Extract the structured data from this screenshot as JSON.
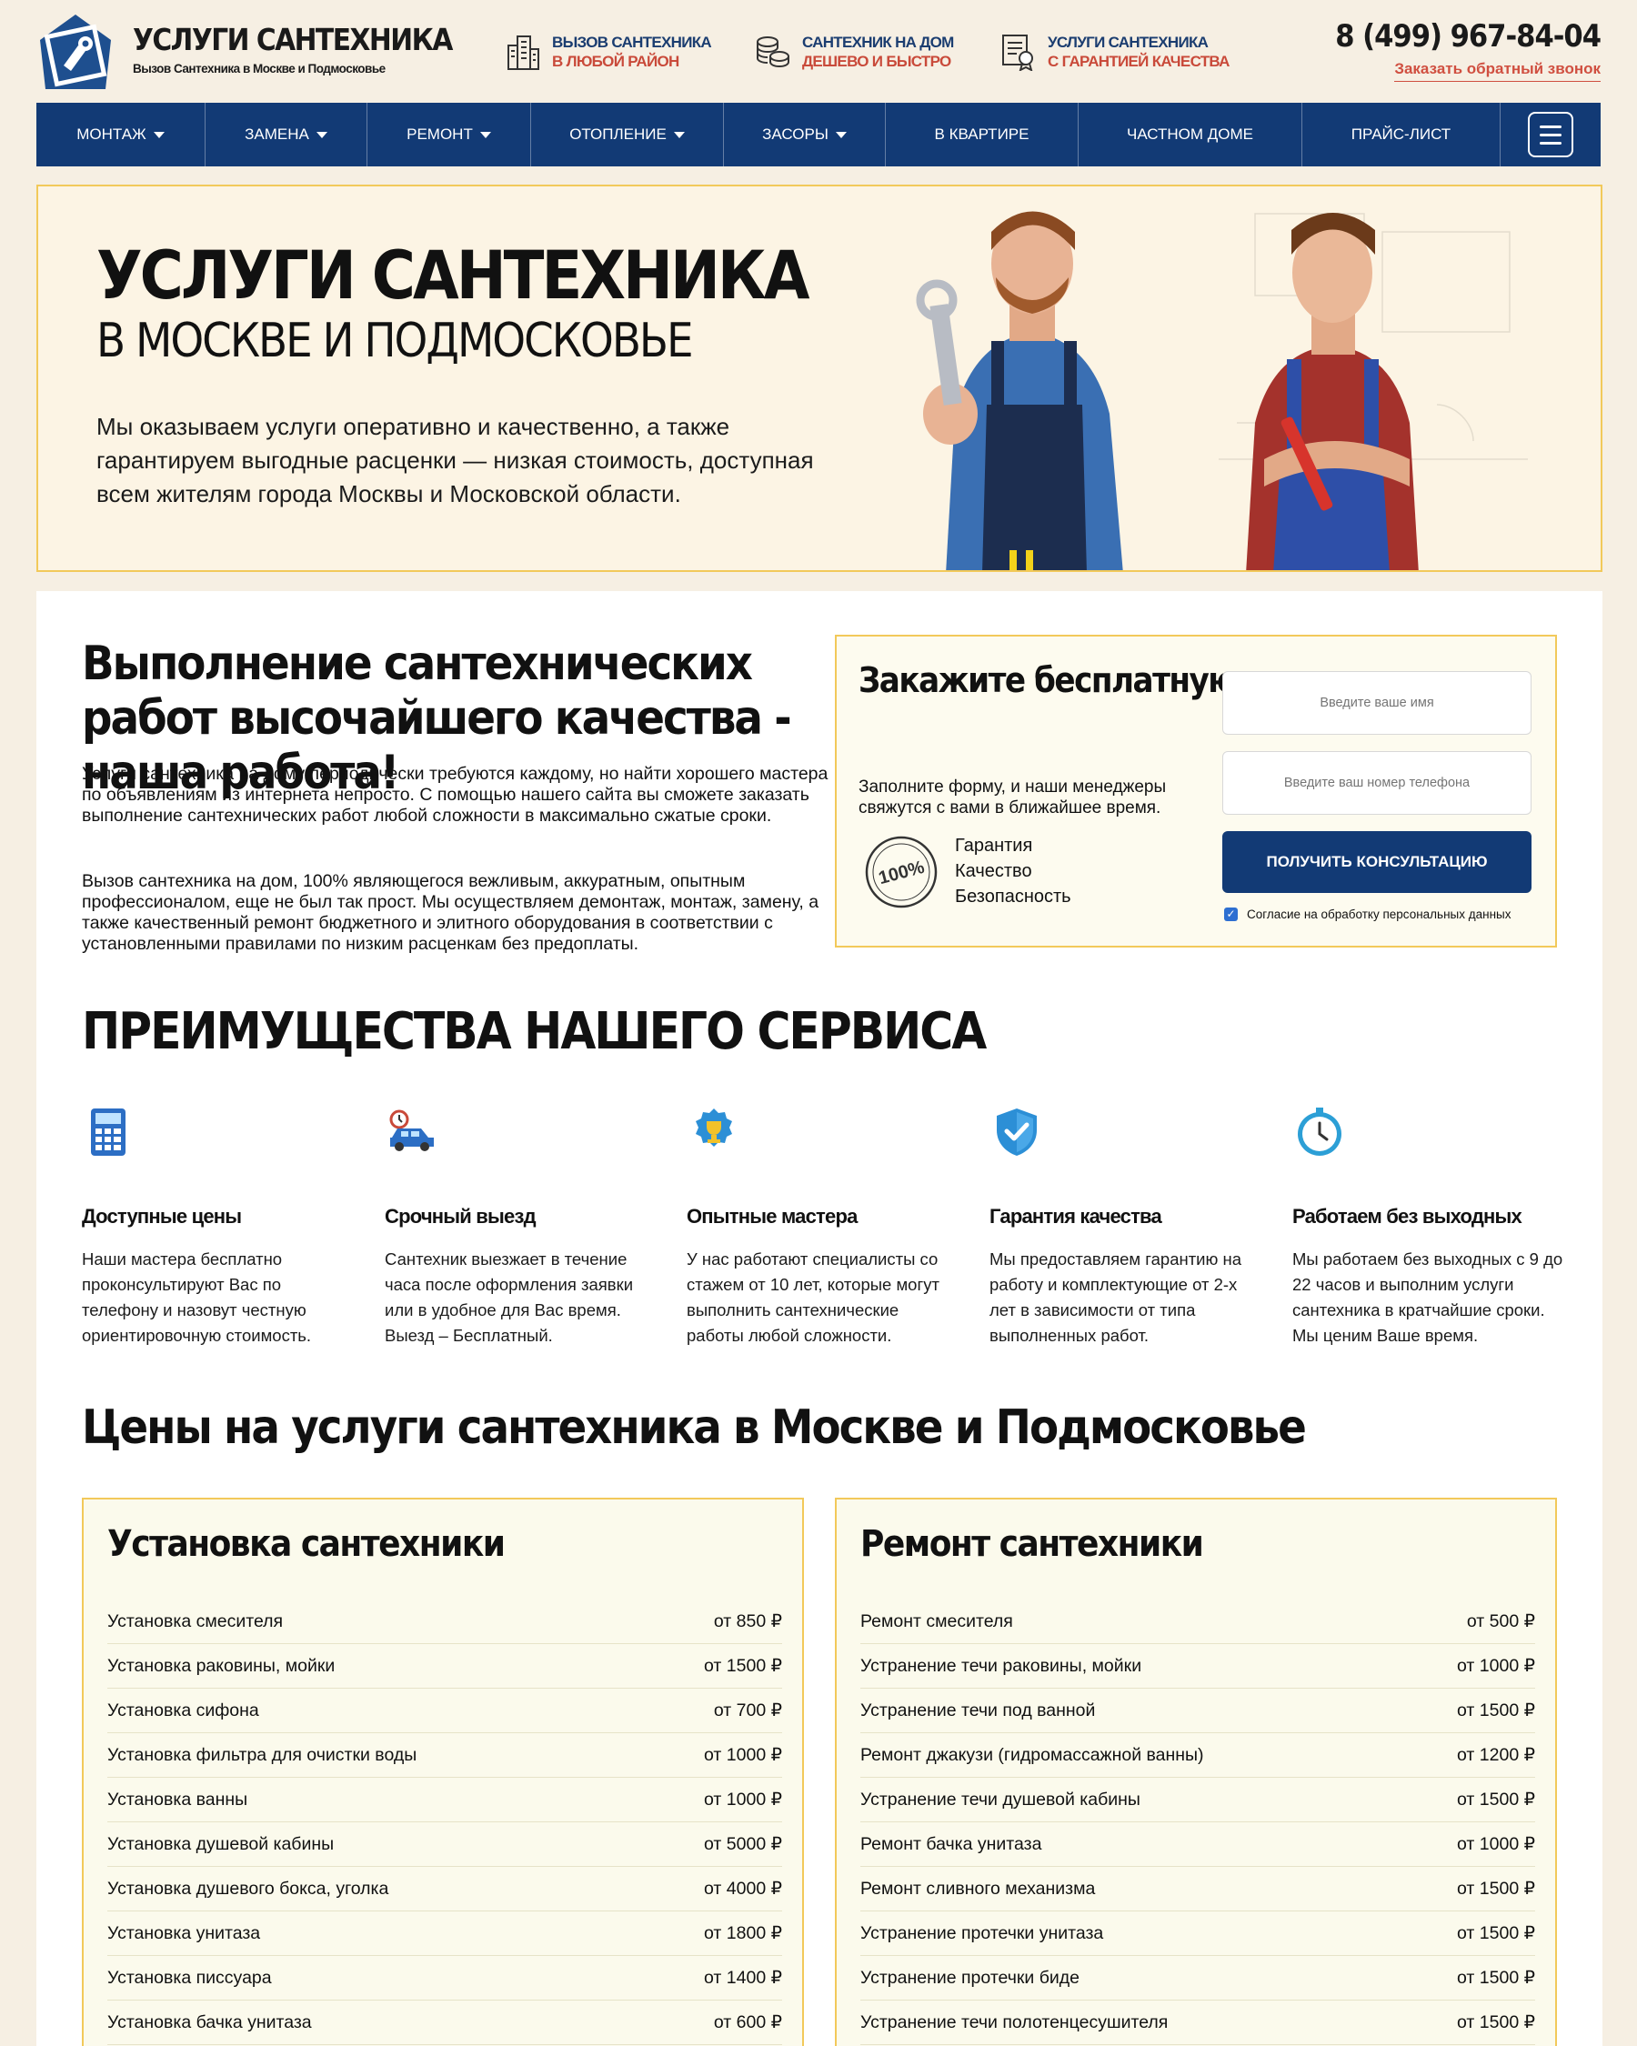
{
  "header": {
    "brand_title": "УСЛУГИ САНТЕХНИКА",
    "brand_subtitle": "Вызов Сантехника в Москве и Подмосковье",
    "features": [
      {
        "icon": "buildings-icon",
        "line1": "ВЫЗОВ САНТЕХНИКА",
        "line2": "В ЛЮБОЙ РАЙОН"
      },
      {
        "icon": "coins-icon",
        "line1": "САНТЕХНИК НА ДОМ",
        "line2": "ДЕШЕВО И БЫСТРО"
      },
      {
        "icon": "certificate-icon",
        "line1": "УСЛУГИ САНТЕХНИКА",
        "line2": "С ГАРАНТИЕЙ КАЧЕСТВА"
      }
    ],
    "phone": "8 (499) 967-84-04",
    "callback": "Заказать обратный звонок"
  },
  "nav": {
    "items": [
      {
        "label": "МОНТАЖ",
        "dropdown": true
      },
      {
        "label": "ЗАМЕНА",
        "dropdown": true
      },
      {
        "label": "РЕМОНТ",
        "dropdown": true
      },
      {
        "label": "ОТОПЛЕНИЕ",
        "dropdown": true
      },
      {
        "label": "ЗАСОРЫ",
        "dropdown": true
      },
      {
        "label": "В КВАРТИРЕ",
        "dropdown": false
      },
      {
        "label": "ЧАСТНОМ ДОМЕ",
        "dropdown": false
      },
      {
        "label": "ПРАЙС-ЛИСТ",
        "dropdown": false
      }
    ]
  },
  "hero": {
    "title": "УСЛУГИ САНТЕХНИКА",
    "subtitle": "В МОСКВЕ И ПОДМОСКОВЬЕ",
    "text": "Мы оказываем услуги оперативно и качественно, а также гарантируем выгодные расценки — низкая стоимость, доступная всем жителям города Москвы и Московской области."
  },
  "intro": {
    "heading": "Выполнение сантехнических работ высочайшего качества - наша работа!",
    "p1": "Услуги сантехника на дому периодически требуются каждому, но найти хорошего мастера по объявлениям из интернета непросто. С помощью нашего сайта вы сможете заказать выполнение сантехнических работ любой сложности в максимально сжатые сроки.",
    "p2": "Вызов сантехника на дом, 100% являющегося вежливым, аккуратным, опытным профессионалом, еще не был так прост. Мы осуществляем демонтаж, монтаж, замену, а также качественный ремонт бюджетного и элитного оборудования в соответствии с установленными правилами по низким расценкам без предоплаты."
  },
  "consult": {
    "heading": "Закажите бесплатную консультацию",
    "text": "Заполните форму, и наши менеджеры свяжутся с вами в ближайшее время.",
    "seal": "100%",
    "guarantees": [
      "Гарантия",
      "Качество",
      "Безопасность"
    ],
    "name_placeholder": "Введите ваше имя",
    "phone_placeholder": "Введите ваш номер телефона",
    "button": "ПОЛУЧИТЬ КОНСУЛЬТАЦИЮ",
    "agree": "Согласие на обработку персональных данных",
    "agree_checked": true
  },
  "advantages": {
    "title": "ПРЕИМУЩЕСТВА НАШЕГО СЕРВИСА",
    "items": [
      {
        "icon": "calculator-icon",
        "title": "Доступные цены",
        "text": "Наши мастера бесплатно проконсультируют Вас по телефону и назовут честную ориентировочную стоимость."
      },
      {
        "icon": "fast-car-icon",
        "title": "Срочный выезд",
        "text": "Сантехник выезжает в течение часа после оформления заявки или в удобное для Вас время. Выезд – Бесплатный."
      },
      {
        "icon": "trophy-badge-icon",
        "title": "Опытные мастера",
        "text": "У нас работают специалисты со стажем от 10 лет, которые могут выполнить сантехнические работы любой сложности."
      },
      {
        "icon": "shield-check-icon",
        "title": "Гарантия качества",
        "text": "Мы предоставляем гарантию на работу и комплектующие от 2-х лет в зависимости от типа выполненных работ."
      },
      {
        "icon": "clock-icon",
        "title": "Работаем без выходных",
        "text": "Мы работаем без выходных с 9 до 22 часов и выполним услуги сантехника в кратчайшие сроки. Мы ценим Ваше время."
      }
    ]
  },
  "prices": {
    "title": "Цены на услуги сантехника в Москве и Подмосковье",
    "cards": [
      {
        "title": "Установка сантехники",
        "rows": [
          {
            "name": "Установка смесителя",
            "price": "от 850 ₽"
          },
          {
            "name": "Установка раковины, мойки",
            "price": "от 1500 ₽"
          },
          {
            "name": "Установка сифона",
            "price": "от 700 ₽"
          },
          {
            "name": "Установка фильтра для очистки воды",
            "price": "от 1000 ₽"
          },
          {
            "name": "Установка ванны",
            "price": "от 1000 ₽"
          },
          {
            "name": "Установка душевой кабины",
            "price": "от 5000 ₽"
          },
          {
            "name": "Установка душевого бокса, уголка",
            "price": "от 4000 ₽"
          },
          {
            "name": "Установка унитаза",
            "price": "от 1800 ₽"
          },
          {
            "name": "Установка писсуара",
            "price": "от 1400 ₽"
          },
          {
            "name": "Установка бачка унитаза",
            "price": "от 600 ₽"
          }
        ]
      },
      {
        "title": "Ремонт сантехники",
        "rows": [
          {
            "name": "Ремонт смесителя",
            "price": "от 500 ₽"
          },
          {
            "name": "Устранение течи раковины, мойки",
            "price": "от 1000 ₽"
          },
          {
            "name": "Устранение течи под ванной",
            "price": "от 1500 ₽"
          },
          {
            "name": "Ремонт джакузи (гидромассажной ванны)",
            "price": "от 1200 ₽"
          },
          {
            "name": "Устранение течи душевой кабины",
            "price": "от 1500 ₽"
          },
          {
            "name": "Ремонт бачка унитаза",
            "price": "от 1000 ₽"
          },
          {
            "name": "Ремонт сливного механизма",
            "price": "от 1500 ₽"
          },
          {
            "name": "Устранение протечки унитаза",
            "price": "от 1500 ₽"
          },
          {
            "name": "Устранение протечки биде",
            "price": "от 1500 ₽"
          },
          {
            "name": "Устранение течи полотенцесушителя",
            "price": "от 1500 ₽"
          }
        ]
      }
    ]
  },
  "colors": {
    "navy": "#123a75",
    "accent_red": "#c94a3a",
    "gold_border": "#f2c95a",
    "page_bg": "#f6efe3"
  }
}
